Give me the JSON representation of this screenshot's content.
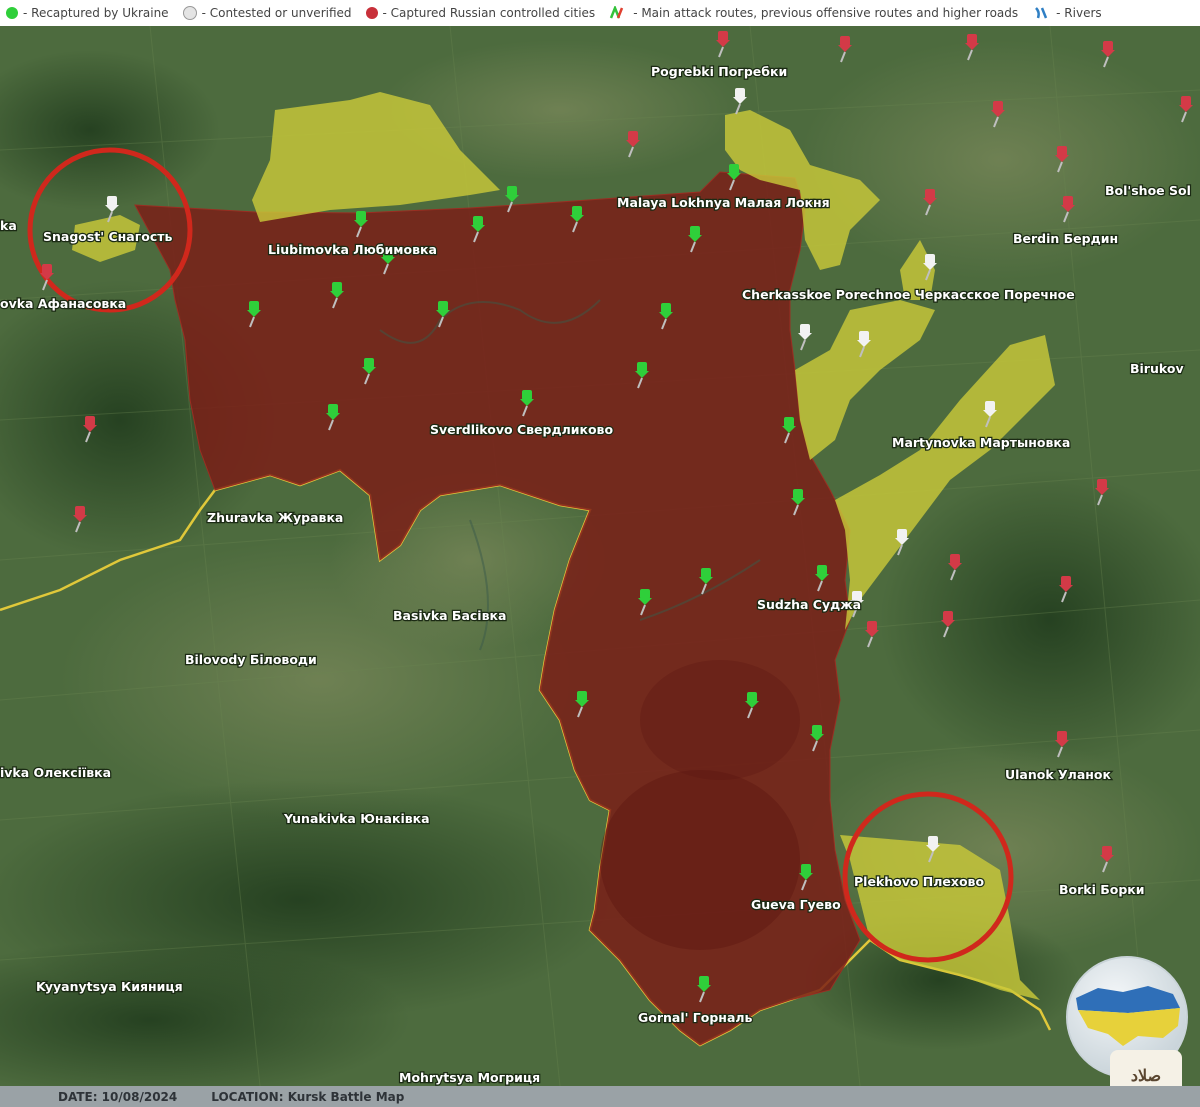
{
  "legend": {
    "recaptured": "- Recaptured by Ukraine",
    "contested": "- Contested or unverified",
    "captured": "- Captured Russian controlled cities",
    "routes": "- Main attack routes, previous offensive routes and higher roads",
    "rivers": "- Rivers"
  },
  "colors": {
    "recaptured": "#2fcf3a",
    "contested": "#d8d8d8",
    "captured": "#c8303a",
    "occupied_area": "#7a1f18",
    "contested_area": "#c8c839",
    "border": "#e0c83a",
    "circle": "#d0281c"
  },
  "places": {
    "pogrebki": "Pogrebki Погребки",
    "malaya": "Malaya Lokhnya Малая Локня",
    "bolshoe": "Bol'shoe Sol",
    "berdin": "Berdin Бердин",
    "snagost": "Snagost' Снагость",
    "liubimovka": "Liubimovka Любимовка",
    "afanasovka": "ovka Афанасовка",
    "cherkasskoe": "Cherkasskoe Porechnoe Черкасское Поречное",
    "birukovka": "Birukov",
    "sverdlikovo": "Sverdlikovo Свердликово",
    "martynovka": "Martynovka Мартыновка",
    "zhuravka": "Zhuravka Журавка",
    "basivka": "Basivka Басівка",
    "sudzha": "Sudzha Суджа",
    "bilovody": "Bilovody Біловоди",
    "oleksiivka": "ivka Олексіївка",
    "yunakivka": "Yunakivka Юнаківка",
    "ulanok": "Ulanok Уланок",
    "plekhovo": "Plekhovo Плехово",
    "gueva": "Gueva Гуево",
    "borki": "Borki Борки",
    "kyianytsia": "Kyyanytsya Кияниця",
    "gornal": "Gornal' Горналь",
    "mohrytsia": "Mohrytsya Могриця",
    "ka": "ka"
  },
  "footer": {
    "date": "DATE: 10/08/2024",
    "location": "LOCATION: Kursk Battle Map"
  },
  "watermark": "صلاد"
}
